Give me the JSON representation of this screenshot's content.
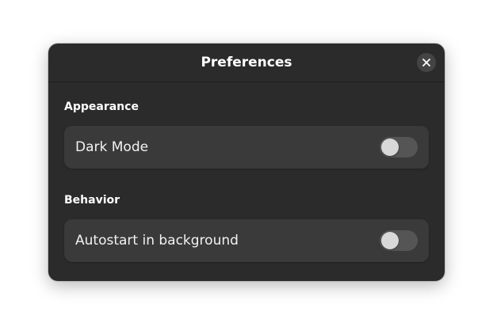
{
  "dialog": {
    "title": "Preferences",
    "close_icon": "close-icon"
  },
  "sections": [
    {
      "heading": "Appearance",
      "rows": [
        {
          "label": "Dark Mode",
          "toggle_on": false
        }
      ]
    },
    {
      "heading": "Behavior",
      "rows": [
        {
          "label": "Autostart in background",
          "toggle_on": false
        }
      ]
    }
  ],
  "colors": {
    "dialog_bg": "#2b2b2b",
    "row_bg": "#3a3a3a",
    "switch_off": "#555555",
    "knob": "#d8d8d8"
  }
}
